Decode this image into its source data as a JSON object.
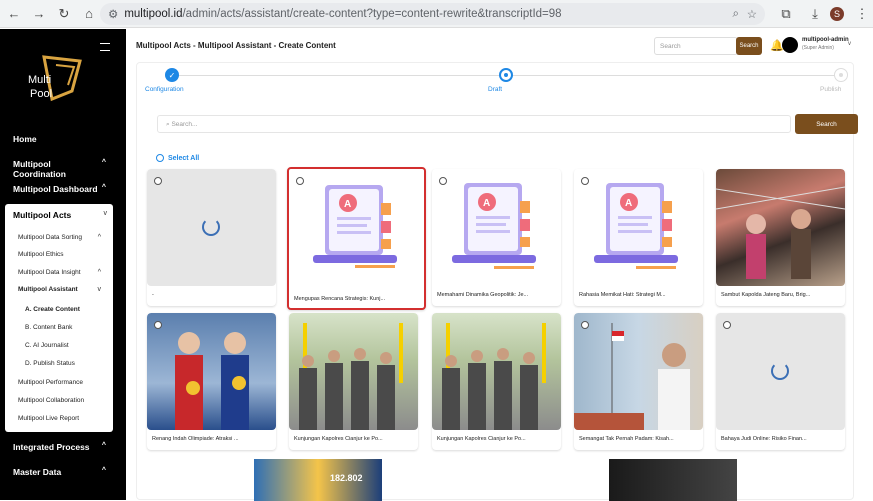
{
  "browser": {
    "url_host": "multipool.id",
    "url_path": "/admin/acts/assistant/create-content?type=content-rewrite&transcriptId=98",
    "profile_initial": "S"
  },
  "sidebar": {
    "top_items": [
      {
        "label": "Home"
      },
      {
        "label": "Multipool Coordination"
      },
      {
        "label": "Multipool Dashboard"
      }
    ],
    "acts": {
      "label": "Multipool Acts",
      "items": [
        {
          "label": "Multipool Data Sorting"
        },
        {
          "label": "Multipool Ethics"
        },
        {
          "label": "Multipool Data Insight"
        },
        {
          "label": "Multipool Assistant"
        },
        {
          "label": "A. Create Content"
        },
        {
          "label": "B. Content Bank"
        },
        {
          "label": "C. AI Journalist"
        },
        {
          "label": "D. Publish Status"
        },
        {
          "label": "Multipool Performance"
        },
        {
          "label": "Multipool Collaboration"
        },
        {
          "label": "Multipool Live Report"
        }
      ]
    },
    "bottom_items": [
      {
        "label": "Integrated Process"
      },
      {
        "label": "Master Data"
      }
    ]
  },
  "header": {
    "title": "Multipool Acts - Multipool Assistant - Create Content",
    "search_placeholder": "Search",
    "search_button": "Search",
    "user_name": "multipool-admin",
    "user_role": "(Super Admin)"
  },
  "steps": [
    {
      "label": "Configuration",
      "state": "done"
    },
    {
      "label": "Draft",
      "state": "current"
    },
    {
      "label": "Publish",
      "state": "pending"
    }
  ],
  "content": {
    "search_placeholder": "Search...",
    "search_button": "Search",
    "select_all": "Select All"
  },
  "cards": [
    {
      "caption": "-",
      "image": "loading"
    },
    {
      "caption": "Mengupas Rencana Strategis: Kunj...",
      "image": "laptop-doc"
    },
    {
      "caption": "Memahami Dinamika Geopolitik: Je...",
      "image": "laptop-doc"
    },
    {
      "caption": "Rahasia Memikat Hati: Strategi M...",
      "image": "laptop-doc"
    },
    {
      "caption": "Sambut Kapolda Jateng Baru, Brig...",
      "image": "photo-ceremony"
    },
    {
      "caption": "Renang Indah Olimpiade: Atraksi ...",
      "image": "photo-athletes"
    },
    {
      "caption": "Kunjungan Kapolres Cianjur ke Po...",
      "image": "photo-police"
    },
    {
      "caption": "Kunjungan Kapolres Cianjur ke Po...",
      "image": "photo-police"
    },
    {
      "caption": "Semangat Tak Pernah Padam: Kisah...",
      "image": "photo-flag"
    },
    {
      "caption": "Bahaya Judi Online: Risiko Finan...",
      "image": "loading"
    }
  ],
  "bottom_thumb_text": "182.802",
  "colors": {
    "accent": "#7a4e1d",
    "primary": "#1e88e5",
    "selected": "#d32f2f"
  }
}
